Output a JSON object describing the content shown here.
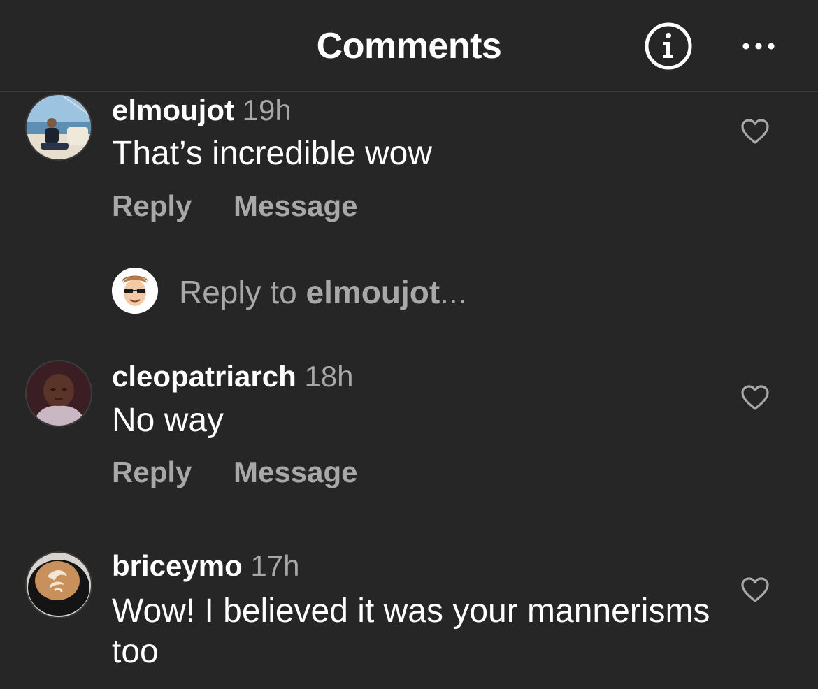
{
  "header": {
    "title": "Comments",
    "info_icon": "info-circle-icon",
    "more_icon": "ellipsis-icon"
  },
  "colors": {
    "background": "#262626",
    "text_primary": "#ffffff",
    "text_secondary": "#a8a8a8",
    "divider": "#3a3a3a"
  },
  "comments": [
    {
      "username": "elmoujot",
      "time": "19h",
      "text": "That’s incredible wow",
      "reply_label": "Reply",
      "message_label": "Message"
    },
    {
      "username": "cleopatriarch",
      "time": "18h",
      "text": "No way",
      "reply_label": "Reply",
      "message_label": "Message"
    },
    {
      "username": "briceymo",
      "time": "17h",
      "text": "Wow! I believed it was your mannerisms too"
    }
  ],
  "reply_box": {
    "prefix": "Reply to ",
    "target": "elmoujot",
    "suffix": "..."
  }
}
